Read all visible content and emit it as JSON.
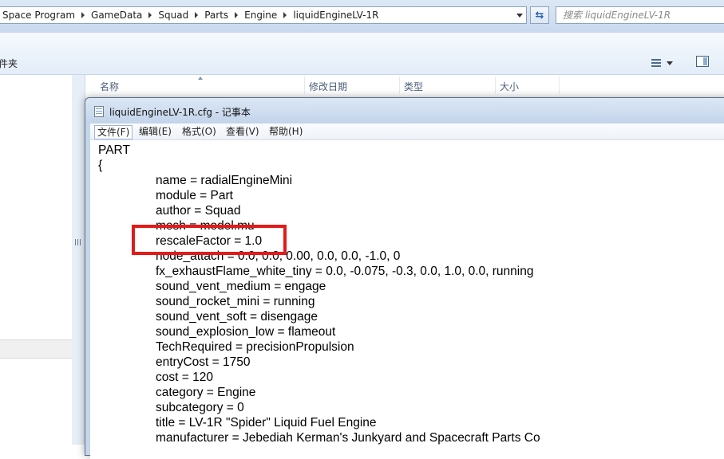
{
  "explorer": {
    "breadcrumbs": [
      "Space Program",
      "GameData",
      "Squad",
      "Parts",
      "Engine",
      "liquidEngineLV-1R"
    ],
    "search_placeholder": "搜索 liquidEngineLV-1R",
    "toolbar_label": "件夹",
    "columns": [
      "名称",
      "修改日期",
      "类型",
      "大小"
    ]
  },
  "notepad": {
    "title": "liquidEngineLV-1R.cfg - 记事本",
    "menu": [
      "文件(F)",
      "编辑(E)",
      "格式(O)",
      "查看(V)",
      "帮助(H)"
    ],
    "lines": [
      "PART",
      "{",
      "name = radialEngineMini",
      "module = Part",
      "author = Squad",
      "mesh = model.mu",
      "rescaleFactor = 1.0",
      "node_attach = 0.0, 0.0, 0.00, 0.0, 0.0, -1.0, 0",
      "fx_exhaustFlame_white_tiny = 0.0, -0.075, -0.3, 0.0, 1.0, 0.0, running",
      "sound_vent_medium = engage",
      "sound_rocket_mini = running",
      "sound_vent_soft = disengage",
      "sound_explosion_low = flameout",
      "TechRequired = precisionPropulsion",
      "entryCost = 1750",
      "cost = 120",
      "category = Engine",
      "subcategory = 0",
      "title = LV-1R \"Spider\" Liquid Fuel Engine",
      "manufacturer = Jebediah Kerman's Junkyard and Spacecraft Parts Co"
    ]
  },
  "colors": {
    "highlight": "#e21b1b",
    "chrome": "#c5d6eb"
  }
}
